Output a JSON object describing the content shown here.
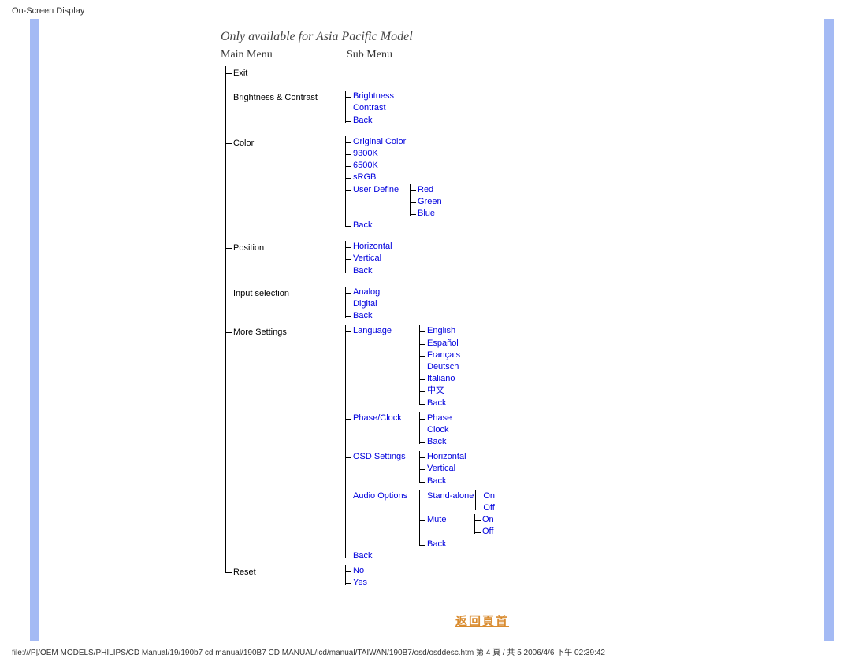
{
  "header": {
    "title": "On-Screen Display"
  },
  "content": {
    "availability": "Only available for Asia Pacific Model",
    "col_main": "Main Menu",
    "col_sub": "Sub Menu",
    "return_link": "返回頁首"
  },
  "menu": {
    "exit": "Exit",
    "brightness_contrast": "Brightness & Contrast",
    "bc_sub": {
      "brightness": "Brightness",
      "contrast": "Contrast",
      "back": "Back"
    },
    "color": "Color",
    "color_sub": {
      "original": "Original Color",
      "k9300": "9300K",
      "k6500": "6500K",
      "srgb": "sRGB",
      "user_define": "User Define",
      "ud_sub": {
        "red": "Red",
        "green": "Green",
        "blue": "Blue"
      },
      "back": "Back"
    },
    "position": "Position",
    "position_sub": {
      "horizontal": "Horizontal",
      "vertical": "Vertical",
      "back": "Back"
    },
    "input": "Input selection",
    "input_sub": {
      "analog": "Analog",
      "digital": "Digital",
      "back": "Back"
    },
    "more": "More Settings",
    "more_sub": {
      "language": "Language",
      "lang_sub": {
        "en": "English",
        "es": "Español",
        "fr": "Français",
        "de": "Deutsch",
        "it": "Italiano",
        "zh": "中文",
        "back": "Back"
      },
      "phase_clock": "Phase/Clock",
      "pc_sub": {
        "phase": "Phase",
        "clock": "Clock",
        "back": "Back"
      },
      "osd": "OSD Settings",
      "osd_sub": {
        "horizontal": "Horizontal",
        "vertical": "Vertical",
        "back": "Back"
      },
      "audio": "Audio Options",
      "audio_sub": {
        "standalone": "Stand-alone",
        "sa_sub": {
          "on": "On",
          "off": "Off"
        },
        "mute": "Mute",
        "mute_sub": {
          "on": "On",
          "off": "Off"
        },
        "back": "Back"
      },
      "back": "Back"
    },
    "reset": "Reset",
    "reset_sub": {
      "no": "No",
      "yes": "Yes"
    }
  },
  "footer": {
    "path": "file:///P|/OEM MODELS/PHILIPS/CD Manual/19/190b7 cd manual/190B7 CD MANUAL/lcd/manual/TAIWAN/190B7/osd/osddesc.htm 第 4 頁 / 共 5 2006/4/6 下午 02:39:42"
  }
}
